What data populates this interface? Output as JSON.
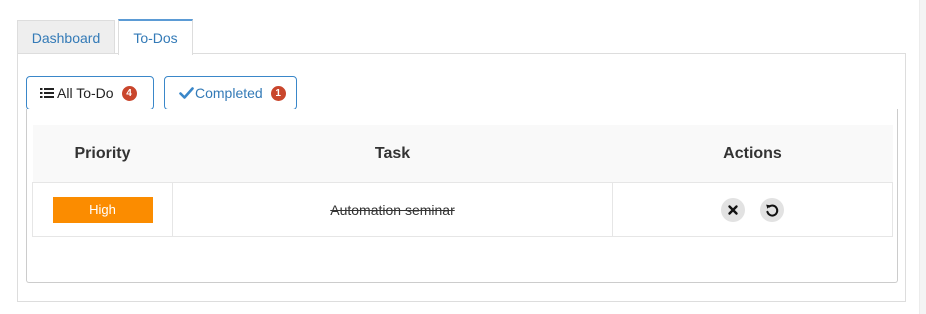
{
  "tabs": [
    {
      "label": "Dashboard",
      "active": false
    },
    {
      "label": "To-Dos",
      "active": true
    }
  ],
  "filters": {
    "all": {
      "label": "All To-Do",
      "count": "4",
      "icon": "list-icon"
    },
    "completed": {
      "label": "Completed",
      "count": "1",
      "icon": "check-icon"
    }
  },
  "table": {
    "headers": [
      "Priority",
      "Task",
      "Actions"
    ],
    "rows": [
      {
        "priority": "High",
        "task": "Automation seminar",
        "completed": true,
        "actions": [
          "delete-icon",
          "undo-icon"
        ]
      }
    ]
  },
  "colors": {
    "accent": "#337ab7",
    "badge": "#c9462c",
    "priority_high": "#fb8c00"
  }
}
